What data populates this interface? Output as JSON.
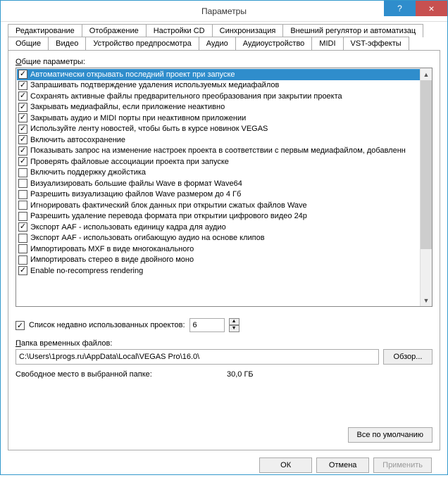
{
  "window": {
    "title": "Параметры",
    "help": "?",
    "close": "×"
  },
  "tabs_row1": [
    "Редактирование",
    "Отображение",
    "Настройки CD",
    "Синхронизация",
    "Внешний регулятор и автоматизац"
  ],
  "tabs_row2": [
    "Общие",
    "Видео",
    "Устройство предпросмотра",
    "Аудио",
    "Аудиоустройство",
    "MIDI",
    "VST-эффекты"
  ],
  "active_tab": "Общие",
  "section_label": "Общие параметры:",
  "options": [
    {
      "checked": true,
      "selected": true,
      "label": "Автоматически открывать последний проект при запуске"
    },
    {
      "checked": true,
      "selected": false,
      "label": "Запрашивать подтверждение удаления используемых медиафайлов"
    },
    {
      "checked": true,
      "selected": false,
      "label": "Сохранять активные файлы предварительного преобразования при закрытии проекта"
    },
    {
      "checked": true,
      "selected": false,
      "label": "Закрывать медиафайлы, если приложение неактивно"
    },
    {
      "checked": true,
      "selected": false,
      "label": "Закрывать аудио и MIDI порты при неактивном приложении"
    },
    {
      "checked": true,
      "selected": false,
      "label": "Используйте ленту новостей, чтобы быть в курсе новинок VEGAS"
    },
    {
      "checked": true,
      "selected": false,
      "label": "Включить автосохранение"
    },
    {
      "checked": true,
      "selected": false,
      "label": "Показывать запрос на изменение настроек проекта в соответствии с первым медиафайлом, добавленн"
    },
    {
      "checked": true,
      "selected": false,
      "label": "Проверять файловые ассоциации проекта при запуске"
    },
    {
      "checked": false,
      "selected": false,
      "label": "Включить поддержку джойстика"
    },
    {
      "checked": false,
      "selected": false,
      "label": "Визуализировать большие файлы Wave в формат Wave64"
    },
    {
      "checked": false,
      "selected": false,
      "label": "Разрешить визуализацию файлов Wave размером до 4 Гб"
    },
    {
      "checked": false,
      "selected": false,
      "label": "Игнорировать фактический блок данных при открытии сжатых файлов Wave"
    },
    {
      "checked": false,
      "selected": false,
      "label": "Разрешить удаление перевода формата при открытии цифрового видео 24p"
    },
    {
      "checked": true,
      "selected": false,
      "label": "Экспорт AAF - использовать единицу кадра для аудио"
    },
    {
      "checked": false,
      "selected": false,
      "label": "Экспорт AAF - использовать огибающую аудио на основе клипов"
    },
    {
      "checked": false,
      "selected": false,
      "label": "Импортировать MXF в виде многоканального"
    },
    {
      "checked": false,
      "selected": false,
      "label": "Импортировать стерео в виде двойного моно"
    },
    {
      "checked": true,
      "selected": false,
      "label": "Enable no-recompress rendering"
    }
  ],
  "recent_projects": {
    "label": "Cписок недавно использованных проектов:",
    "value": "6"
  },
  "temp_folder": {
    "label": "Папка временных файлов:",
    "path": "C:\\Users\\1progs.ru\\AppData\\Local\\VEGAS Pro\\16.0\\",
    "browse": "Обзор..."
  },
  "free_space": {
    "label": "Свободное место в выбранной папке:",
    "value": "30,0 ГБ"
  },
  "defaults_button": "Все по умолчанию",
  "buttons": {
    "ok": "ОК",
    "cancel": "Отмена",
    "apply": "Применить"
  }
}
